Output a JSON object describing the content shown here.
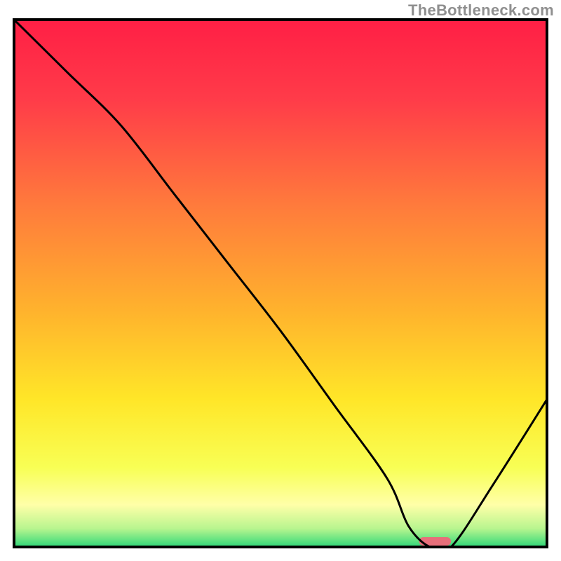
{
  "watermark": "TheBottleneck.com",
  "chart_data": {
    "type": "line",
    "title": "",
    "xlabel": "",
    "ylabel": "",
    "xlim": [
      0,
      100
    ],
    "ylim": [
      0,
      100
    ],
    "grid": false,
    "legend": false,
    "series": [
      {
        "name": "bottleneck-curve",
        "x": [
          0,
          10,
          20,
          30,
          40,
          50,
          60,
          70,
          74,
          78,
          82,
          90,
          100
        ],
        "y": [
          100,
          90,
          80,
          67,
          54,
          41,
          27,
          13,
          4,
          0,
          0,
          12,
          28
        ]
      }
    ],
    "marker": {
      "name": "optimal-range",
      "shape": "rounded-bar",
      "x_start": 76,
      "x_end": 82,
      "y": 0,
      "color": "#e76f7a"
    },
    "background_gradient": {
      "stops": [
        {
          "pos": 0.0,
          "color": "#ff1f45"
        },
        {
          "pos": 0.15,
          "color": "#ff3b49"
        },
        {
          "pos": 0.35,
          "color": "#ff7a3c"
        },
        {
          "pos": 0.55,
          "color": "#ffb22d"
        },
        {
          "pos": 0.72,
          "color": "#ffe628"
        },
        {
          "pos": 0.85,
          "color": "#f8ff55"
        },
        {
          "pos": 0.92,
          "color": "#ffffa8"
        },
        {
          "pos": 0.965,
          "color": "#b8f58f"
        },
        {
          "pos": 1.0,
          "color": "#2fd879"
        }
      ]
    },
    "frame_color": "#000000",
    "line_color": "#000000",
    "line_width": 3
  }
}
